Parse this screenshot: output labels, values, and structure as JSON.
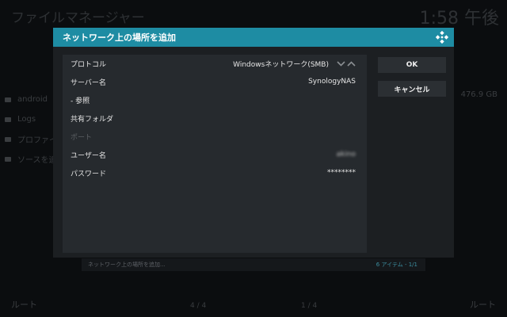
{
  "background": {
    "title": "ファイルマネージャー",
    "clock": "1:58 午後",
    "list_items": [
      {
        "label": "android"
      },
      {
        "label": "Logs"
      },
      {
        "label": "プロファイ"
      },
      {
        "label": "ソースを追"
      }
    ],
    "size": "476.9 GB",
    "footer_left": "ルート",
    "footer_right": "ルート",
    "page_left": "4 / 4",
    "page_right": "1 / 4"
  },
  "dialog": {
    "title": "ネットワーク上の場所を追加",
    "fields": {
      "protocol": {
        "label": "プロトコル",
        "value": "Windowsネットワーク(SMB)"
      },
      "server": {
        "label": "サーバー名",
        "value": "SynologyNAS"
      },
      "browse": {
        "label": "- 参照"
      },
      "share": {
        "label": "共有フォルダ"
      },
      "port": {
        "label": "ポート"
      },
      "username": {
        "label": "ユーザー名",
        "value": "akino"
      },
      "password": {
        "label": "パスワード",
        "value": "********"
      }
    },
    "buttons": {
      "ok": "OK",
      "cancel": "キャンセル"
    }
  },
  "status_bar": {
    "left": "ネットワーク上の場所を追加...",
    "right": "6 アイテム - 1/1"
  },
  "colors": {
    "accent": "#1e8ca3",
    "dialog_bg": "#1c1f22",
    "panel_bg": "#262a2e",
    "button_bg": "#2b2f33"
  },
  "icons": {
    "logo": "kodi-logo-icon",
    "folder": "folder-icon",
    "arrows": "chevron-down-up-icon"
  }
}
